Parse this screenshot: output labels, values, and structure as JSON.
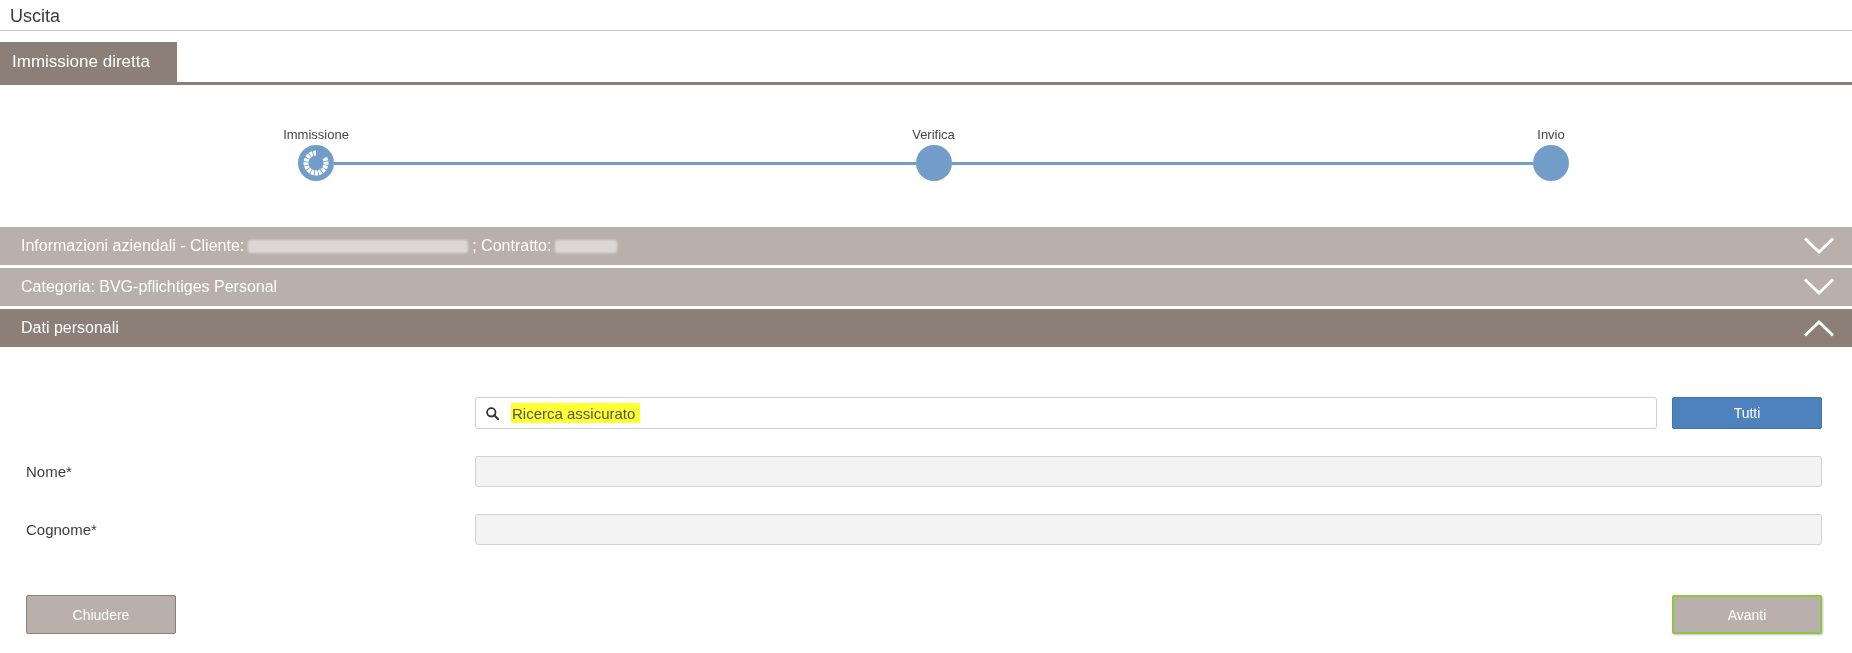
{
  "page_title": "Uscita",
  "tabs": [
    {
      "label": "Immissione diretta",
      "selected": true
    }
  ],
  "steps": [
    {
      "label": "Immissione",
      "selected": true
    },
    {
      "label": "Verifica",
      "selected": false
    },
    {
      "label": "Invio",
      "selected": false
    }
  ],
  "sections": [
    {
      "title": [
        {
          "kind": "text",
          "text": "Informazioni aziendali - Cliente:"
        },
        {
          "kind": "redacted",
          "wide": true
        },
        {
          "kind": "text",
          "text": "; Contratto:"
        },
        {
          "kind": "redacted",
          "wide": false
        }
      ],
      "expanded": false
    },
    {
      "title": [
        {
          "kind": "text",
          "text": "Categoria: BVG-pflichtiges Personal"
        }
      ],
      "expanded": false
    },
    {
      "title": [
        {
          "kind": "text",
          "text": "Dati personali"
        }
      ],
      "expanded": true
    }
  ],
  "search": {
    "placeholder": "Ricerca assicurato",
    "highlighted": true,
    "button": "Tutti"
  },
  "fields": [
    {
      "label": "Nome*",
      "disabled": true
    },
    {
      "label": "Cognome*",
      "disabled": true
    }
  ],
  "actions": [
    {
      "label": "Chiudere",
      "focused": false
    },
    {
      "label": "Avanti",
      "focused": true
    }
  ]
}
